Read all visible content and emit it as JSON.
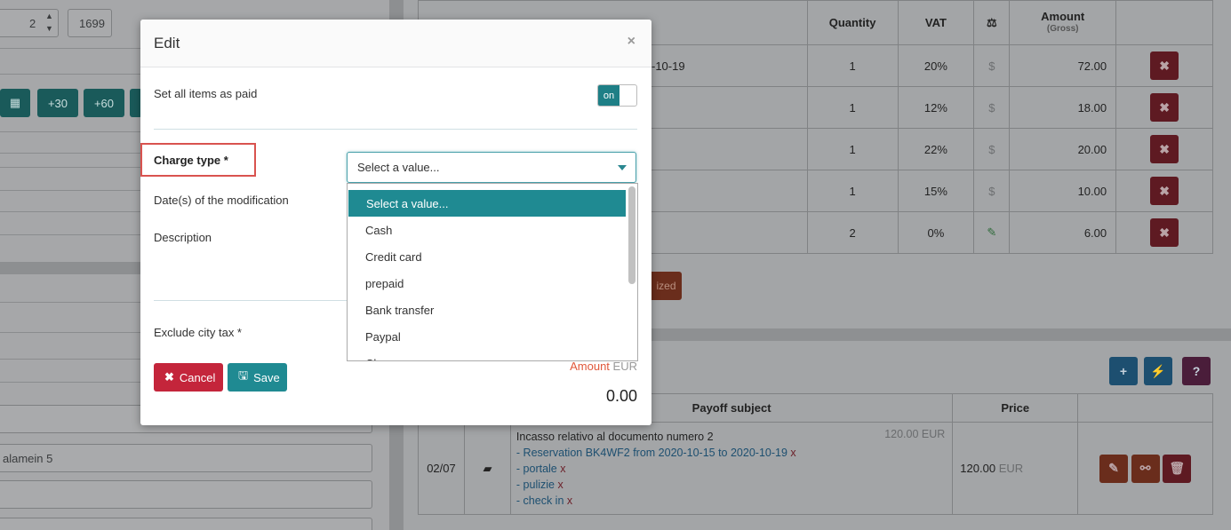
{
  "background": {
    "left": {
      "spin_value": "2",
      "top_field_value": "1699",
      "quick_buttons": [
        "+30",
        "+60"
      ],
      "address_value": "alamein 5"
    },
    "top_table": {
      "headers": {
        "quantity": "Quantity",
        "vat": "VAT",
        "amount": "Amount",
        "amount_sub": "(Gross)"
      },
      "rows": [
        {
          "desc": "-10-19",
          "quantity": "1",
          "vat": "20%",
          "icon": "$",
          "amount": "72.00"
        },
        {
          "desc": "",
          "quantity": "1",
          "vat": "12%",
          "icon": "$",
          "amount": "18.00"
        },
        {
          "desc": "",
          "quantity": "1",
          "vat": "22%",
          "icon": "$",
          "amount": "20.00"
        },
        {
          "desc": "",
          "quantity": "1",
          "vat": "15%",
          "icon": "$",
          "amount": "10.00"
        },
        {
          "desc": "",
          "quantity": "2",
          "vat": "0%",
          "icon": "✎",
          "amount": "6.00"
        }
      ],
      "partial_button": "ized"
    },
    "payoff_table": {
      "headers": {
        "subject": "Payoff subject",
        "price": "Price"
      },
      "row": {
        "date": "02/07",
        "title": "Incasso relativo al documento numero 2",
        "title_amount": "120.00 EUR",
        "lines": [
          "- Reservation BK4WF2 from 2020-10-15 to 2020-10-19",
          "- portale",
          "- pulizie",
          "- check in"
        ],
        "remove_mark": "x",
        "price": "120.00",
        "price_unit": "EUR"
      }
    }
  },
  "modal": {
    "title": "Edit",
    "close": "×",
    "set_all_paid_label": "Set all items as paid",
    "toggle_label": "on",
    "charge_type_label": "Charge type  *",
    "dates_label": "Date(s) of the modification",
    "description_label": "Description",
    "exclude_city_tax_label": "Exclude city tax  *",
    "select_value": "Select a value...",
    "options": [
      "Select a value...",
      "Cash",
      "Credit card",
      "prepaid",
      "Bank transfer",
      "Paypal",
      "Cheque"
    ],
    "cancel_label": "Cancel",
    "save_label": "Save",
    "amount_label": "Amount",
    "amount_unit": "EUR",
    "amount_value": "0.00"
  }
}
